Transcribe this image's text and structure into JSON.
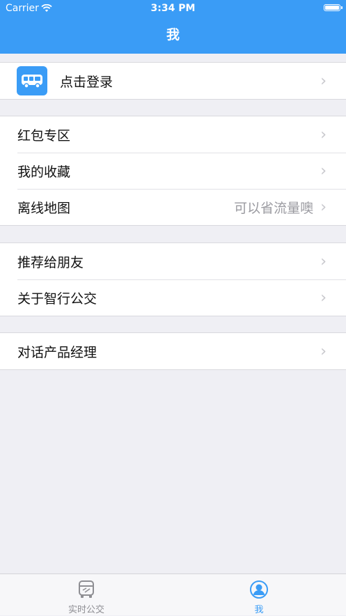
{
  "status": {
    "carrier": "Carrier",
    "time": "3:34 PM"
  },
  "nav": {
    "title": "我"
  },
  "login": {
    "label": "点击登录"
  },
  "group1": [
    {
      "label": "红包专区",
      "detail": ""
    },
    {
      "label": "我的收藏",
      "detail": ""
    },
    {
      "label": "离线地图",
      "detail": "可以省流量噢"
    }
  ],
  "group2": [
    {
      "label": "推荐给朋友"
    },
    {
      "label": "关于智行公交"
    }
  ],
  "group3": [
    {
      "label": "对话产品经理"
    }
  ],
  "tabs": [
    {
      "label": "实时公交",
      "icon": "bus-icon",
      "active": false
    },
    {
      "label": "我",
      "icon": "person-icon",
      "active": true
    }
  ],
  "colors": {
    "accent": "#3a9cf6",
    "inactive": "#8e8e93",
    "background": "#efeff4"
  }
}
